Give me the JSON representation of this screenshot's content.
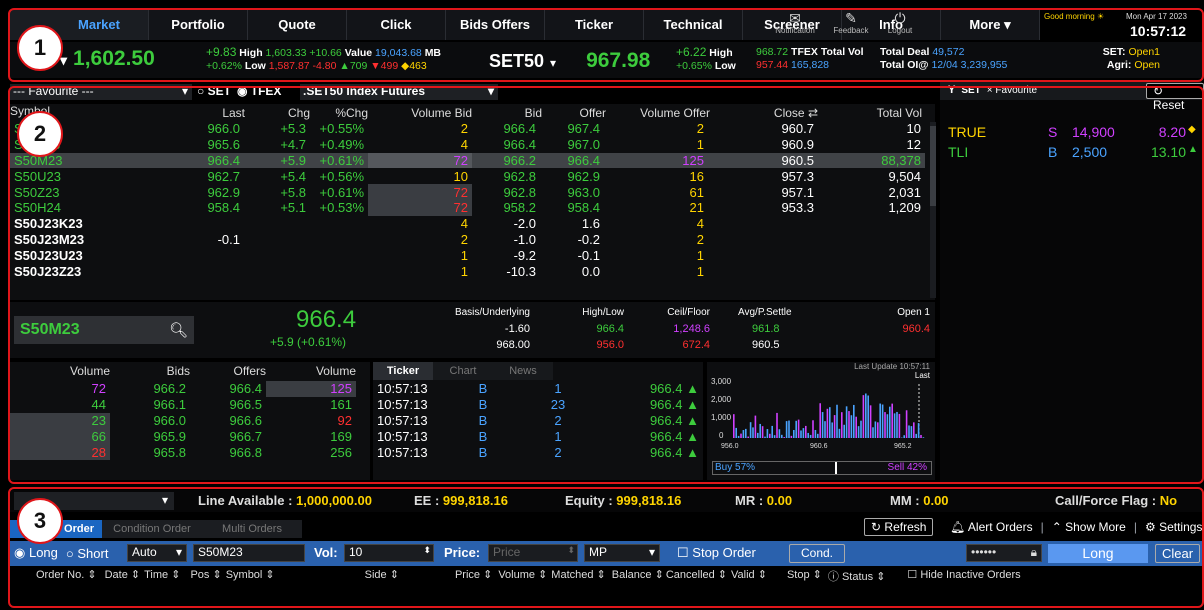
{
  "nav": {
    "tabs": [
      "Market",
      "Portfolio",
      "Quote",
      "Click",
      "Bids Offers",
      "Ticker",
      "Technical",
      "Screener",
      "Info",
      "More"
    ],
    "active": "Market"
  },
  "util": {
    "notification": "Notification",
    "feedback": "Feedback",
    "logout": "Logout"
  },
  "greeting": "Good morning",
  "date": "Mon Apr 17 2023",
  "time": "10:57:12",
  "index1": {
    "name": "SET",
    "value": "1,602.50",
    "chg": "+9.83",
    "pct": "+0.62%",
    "high_lbl": "High",
    "high": "1,603.33",
    "low_lbl": "Low",
    "low": "1,587.87",
    "chg2": "+10.66",
    "chg3": "-4.80",
    "value_lbl": "Value",
    "value_amt": "19,043.68",
    "unit": "MB",
    "up": "709",
    "down": "499",
    "unch": "463"
  },
  "index2": {
    "name": "SET50",
    "value": "967.98",
    "chg": "+6.22",
    "pct": "+0.65%",
    "high_lbl": "High",
    "high": "968.72",
    "low_lbl": "Low",
    "low": "957.44"
  },
  "tfex": {
    "label": "TFEX",
    "total_vol_lbl": "Total Vol",
    "total_vol": "165,828",
    "deal_lbl": "Total Deal",
    "deal": "49,572",
    "oi_lbl": "Total OI@",
    "oi_date": "12/04",
    "oi": "3,239,955"
  },
  "status": {
    "set_lbl": "SET:",
    "set": "Open1",
    "agri_lbl": "Agri:",
    "agri": "Open"
  },
  "filter": {
    "favourite": "--- Favourite ---",
    "set": "SET",
    "tfex": "TFEX",
    "market": ".SET50 Index Futures"
  },
  "cols": [
    "Symbol",
    "Last",
    "Chg",
    "%Chg",
    "Volume Bid",
    "Bid",
    "Offer",
    "Volume Offer",
    "Close",
    "Total Vol"
  ],
  "rows": [
    {
      "sym": "S50J23",
      "last": "966.0",
      "chg": "+5.3",
      "pct": "+0.55%",
      "vb": "2",
      "bid": "966.4",
      "off": "967.4",
      "vo": "2",
      "close": "960.7",
      "tv": "10"
    },
    {
      "sym": "S50K23",
      "last": "965.6",
      "chg": "+4.7",
      "pct": "+0.49%",
      "vb": "4",
      "bid": "966.4",
      "off": "967.0",
      "vo": "1",
      "close": "960.9",
      "tv": "12"
    },
    {
      "sym": "S50M23",
      "last": "966.4",
      "chg": "+5.9",
      "pct": "+0.61%",
      "vb": "72",
      "bid": "966.2",
      "off": "966.4",
      "vo": "125",
      "close": "960.5",
      "tv": "88,378"
    },
    {
      "sym": "S50U23",
      "last": "962.7",
      "chg": "+5.4",
      "pct": "+0.56%",
      "vb": "10",
      "bid": "962.8",
      "off": "962.9",
      "vo": "16",
      "close": "957.3",
      "tv": "9,504"
    },
    {
      "sym": "S50Z23",
      "last": "962.9",
      "chg": "+5.8",
      "pct": "+0.61%",
      "vb": "72",
      "bid": "962.8",
      "off": "963.0",
      "vo": "61",
      "close": "957.1",
      "tv": "2,031"
    },
    {
      "sym": "S50H24",
      "last": "958.4",
      "chg": "+5.1",
      "pct": "+0.53%",
      "vb": "72",
      "bid": "958.2",
      "off": "958.4",
      "vo": "21",
      "close": "953.3",
      "tv": "1,209"
    },
    {
      "sym": "S50J23K23",
      "last": "",
      "chg": "",
      "pct": "",
      "vb": "4",
      "bid": "-2.0",
      "off": "1.6",
      "vo": "4",
      "close": "",
      "tv": ""
    },
    {
      "sym": "S50J23M23",
      "last": "-0.1",
      "chg": "",
      "pct": "",
      "vb": "2",
      "bid": "-1.0",
      "off": "-0.2",
      "vo": "2",
      "close": "",
      "tv": ""
    },
    {
      "sym": "S50J23U23",
      "last": "",
      "chg": "",
      "pct": "",
      "vb": "1",
      "bid": "-9.2",
      "off": "-0.1",
      "vo": "1",
      "close": "",
      "tv": ""
    },
    {
      "sym": "S50J23Z23",
      "last": "",
      "chg": "",
      "pct": "",
      "vb": "1",
      "bid": "-10.3",
      "off": "0.0",
      "vo": "1",
      "close": "",
      "tv": ""
    }
  ],
  "detail": {
    "symbol": "S50M23",
    "price": "966.4",
    "chg": "+5.9 (+0.61%)",
    "basis_lbl": "Basis/Underlying",
    "basis": "-1.60",
    "under": "968.00",
    "hl_lbl": "High/Low",
    "high": "966.4",
    "low": "956.0",
    "cf_lbl": "Ceil/Floor",
    "ceil": "1,248.6",
    "floor": "672.4",
    "avg_lbl": "Avg/P.Settle",
    "avg": "961.8",
    "psettle": "960.5",
    "open_lbl": "Open 1",
    "open": "960.4"
  },
  "depth": {
    "cols": [
      "Volume",
      "Bids",
      "Offers",
      "Volume"
    ],
    "rows": [
      [
        "72",
        "966.2",
        "966.4",
        "125"
      ],
      [
        "44",
        "966.1",
        "966.5",
        "161"
      ],
      [
        "23",
        "966.0",
        "966.6",
        "92"
      ],
      [
        "66",
        "965.9",
        "966.7",
        "169"
      ],
      [
        "28",
        "965.8",
        "966.8",
        "256"
      ]
    ]
  },
  "ticker": {
    "tabs": [
      "Ticker",
      "Chart",
      "News"
    ],
    "rows": [
      [
        "10:57:13",
        "B",
        "1",
        "966.4"
      ],
      [
        "10:57:13",
        "B",
        "23",
        "966.4"
      ],
      [
        "10:57:13",
        "B",
        "2",
        "966.4"
      ],
      [
        "10:57:13",
        "B",
        "1",
        "966.4"
      ],
      [
        "10:57:13",
        "B",
        "2",
        "966.4"
      ]
    ]
  },
  "mini": {
    "last_update": "Last Update 10:57:11",
    "last": "Last",
    "y": [
      "3,000",
      "2,000",
      "1,000",
      "0"
    ],
    "x": [
      "956.0",
      "960.6",
      "965.2"
    ],
    "buy": "Buy 57%",
    "sell": "Sell 42%",
    "buy_pct": 57
  },
  "watch": {
    "filter": "SET",
    "fav": "Favourite",
    "reset": "Reset",
    "rows": [
      {
        "sym": "TRUE",
        "side": "S",
        "vol": "14,900",
        "px": "8.20"
      },
      {
        "sym": "TLI",
        "side": "B",
        "vol": "2,500",
        "px": "13.10"
      }
    ]
  },
  "acct": {
    "line_lbl": "Line Available :",
    "line": "1,000,000.00",
    "ee_lbl": "EE :",
    "ee": "999,818.16",
    "eq_lbl": "Equity :",
    "eq": "999,818.16",
    "mr_lbl": "MR :",
    "mr": "0.00",
    "mm_lbl": "MM :",
    "mm": "0.00",
    "cf_lbl": "Call/Force Flag :",
    "cf": "No"
  },
  "order": {
    "tabs": [
      "Order",
      "Condition Order",
      "Multi Orders"
    ],
    "refresh": "Refresh",
    "alert": "Alert Orders",
    "more": "Show More",
    "settings": "Settings",
    "long": "Long",
    "short": "Short",
    "auto": "Auto",
    "symbol": "S50M23",
    "vol_lbl": "Vol:",
    "vol": "10",
    "price_lbl": "Price:",
    "price_ph": "Price",
    "mp": "MP",
    "stop": "Stop Order",
    "cond": "Cond.",
    "pin": "••••••",
    "submit": "Long",
    "clear": "Clear"
  },
  "ocols": [
    "Order No.",
    "Date",
    "Time",
    "Pos",
    "Symbol",
    "Side",
    "Price",
    "Volume",
    "Matched",
    "Balance",
    "Cancelled",
    "Valid",
    "Stop",
    "Status",
    "Hide Inactive Orders"
  ],
  "markers": [
    "1",
    "2",
    "3"
  ]
}
